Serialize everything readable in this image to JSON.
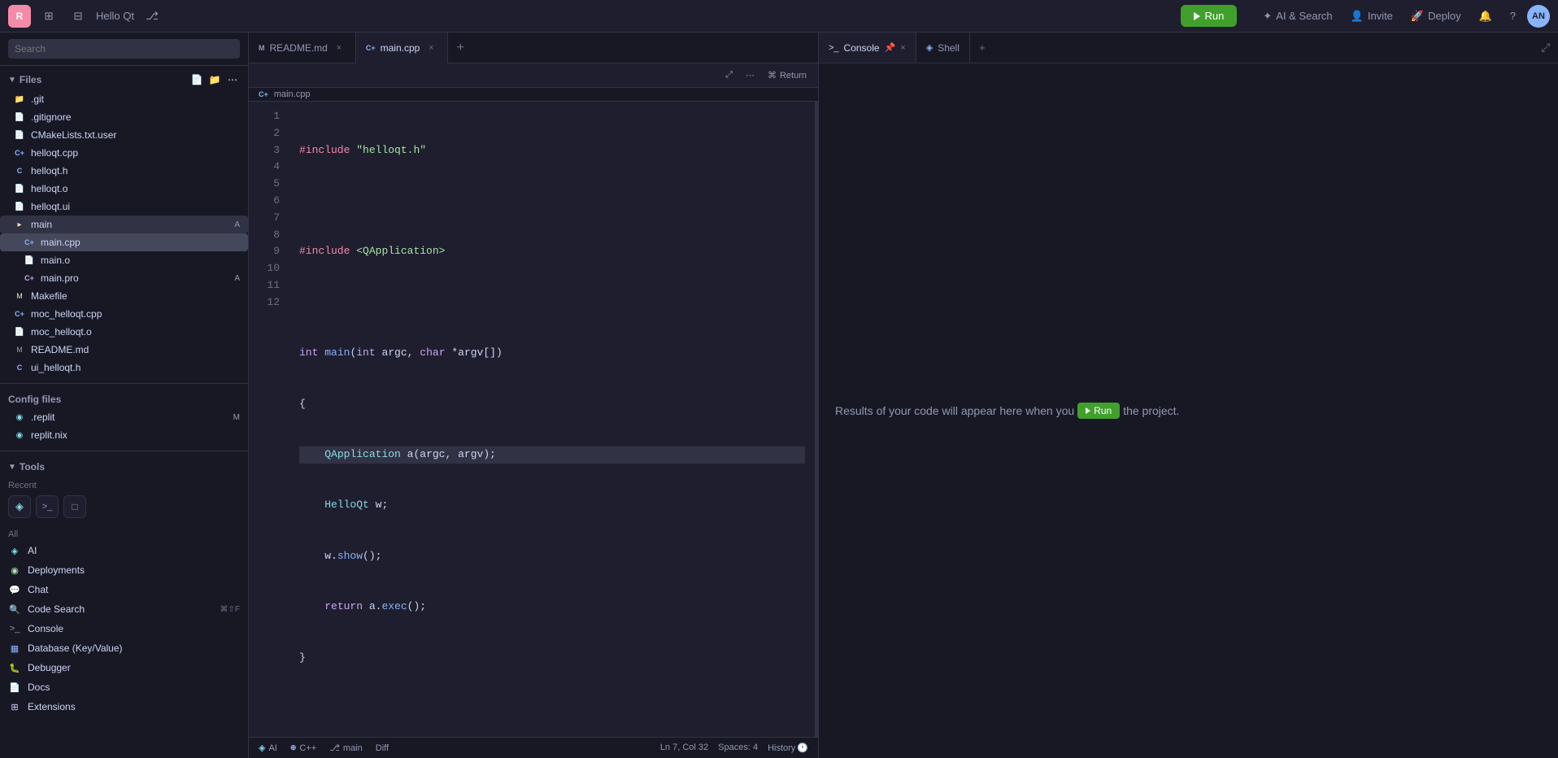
{
  "app": {
    "name": "Hello Qt",
    "logo_text": "R"
  },
  "topbar": {
    "run_label": "Run",
    "ai_search_label": "AI & Search",
    "invite_label": "Invite",
    "deploy_label": "Deploy",
    "avatar_text": "AN"
  },
  "sidebar": {
    "search_placeholder": "Search",
    "files_label": "Files",
    "config_files_label": "Config files",
    "tools_label": "Tools",
    "recent_label": "Recent",
    "all_label": "All",
    "files": [
      {
        "name": ".git",
        "icon": "folder",
        "type": "folder"
      },
      {
        "name": ".gitignore",
        "icon": "file",
        "type": "file"
      },
      {
        "name": "CMakeLists.txt.user",
        "icon": "file",
        "type": "file"
      },
      {
        "name": "helloqt.cpp",
        "icon": "cpp",
        "type": "cpp"
      },
      {
        "name": "helloqt.h",
        "icon": "h",
        "type": "h"
      },
      {
        "name": "helloqt.o",
        "icon": "file",
        "type": "file"
      },
      {
        "name": "helloqt.ui",
        "icon": "file",
        "type": "file"
      },
      {
        "name": "main",
        "icon": "folder",
        "type": "folder",
        "badge": "A",
        "active": true
      },
      {
        "name": "main.cpp",
        "icon": "cpp",
        "type": "cpp",
        "selected": true
      },
      {
        "name": "main.o",
        "icon": "file",
        "type": "file"
      },
      {
        "name": "main.pro",
        "icon": "pro",
        "type": "pro",
        "badge": "A"
      },
      {
        "name": "Makefile",
        "icon": "mk",
        "type": "mk"
      },
      {
        "name": "moc_helloqt.cpp",
        "icon": "cpp",
        "type": "cpp"
      },
      {
        "name": "moc_helloqt.o",
        "icon": "file",
        "type": "file"
      },
      {
        "name": "README.md",
        "icon": "md",
        "type": "md"
      },
      {
        "name": "ui_helloqt.h",
        "icon": "h",
        "type": "h"
      }
    ],
    "config_files": [
      {
        "name": ".replit",
        "icon": "replit",
        "badge": "M"
      },
      {
        "name": "replit.nix",
        "icon": "replit"
      }
    ],
    "tools": {
      "recent_items": [
        {
          "name": "AI",
          "icon": "◈"
        },
        {
          "name": "Shell",
          "icon": ">_"
        },
        {
          "name": "Console",
          "icon": "□"
        }
      ],
      "all_items": [
        {
          "name": "AI",
          "icon": "◈"
        },
        {
          "name": "Deployments",
          "icon": "◉"
        },
        {
          "name": "Chat",
          "icon": "💬"
        },
        {
          "name": "Code Search",
          "icon": "🔍",
          "shortcut": "⌘⇧F"
        },
        {
          "name": "Console",
          "icon": ">_"
        },
        {
          "name": "Database (Key/Value)",
          "icon": "▦"
        },
        {
          "name": "Debugger",
          "icon": "🐛"
        },
        {
          "name": "Docs",
          "icon": "📄"
        },
        {
          "name": "Extensions",
          "icon": "⊞"
        }
      ]
    }
  },
  "editor": {
    "tabs": [
      {
        "name": "README.md",
        "icon": "md",
        "active": false
      },
      {
        "name": "main.cpp",
        "icon": "cpp",
        "active": true
      }
    ],
    "filepath": "main.cpp",
    "code_lines": [
      {
        "num": 1,
        "content": "#include \"helloqt.h\"",
        "type": "include"
      },
      {
        "num": 2,
        "content": "",
        "type": "blank"
      },
      {
        "num": 3,
        "content": "#include <QApplication>",
        "type": "include"
      },
      {
        "num": 4,
        "content": "",
        "type": "blank"
      },
      {
        "num": 5,
        "content": "int main(int argc, char *argv[])",
        "type": "code"
      },
      {
        "num": 6,
        "content": "{",
        "type": "code"
      },
      {
        "num": 7,
        "content": "    QApplication a(argc, argv);",
        "type": "code",
        "highlighted": true
      },
      {
        "num": 8,
        "content": "    HelloQt w;",
        "type": "code"
      },
      {
        "num": 9,
        "content": "    w.show();",
        "type": "code"
      },
      {
        "num": 10,
        "content": "    return a.exec();",
        "type": "code"
      },
      {
        "num": 11,
        "content": "}",
        "type": "code"
      },
      {
        "num": 12,
        "content": "",
        "type": "blank"
      }
    ],
    "status": {
      "ai": "AI",
      "lang": "C++",
      "branch": "main",
      "diff": "Diff",
      "cursor": "Ln 7, Col 32",
      "spaces": "Spaces: 4",
      "history": "History"
    }
  },
  "console": {
    "tabs": [
      {
        "name": "Console",
        "active": true
      },
      {
        "name": "Shell",
        "active": false
      }
    ],
    "message": "Results of your code will appear here when you",
    "run_label": "Run",
    "message_suffix": "the project."
  }
}
